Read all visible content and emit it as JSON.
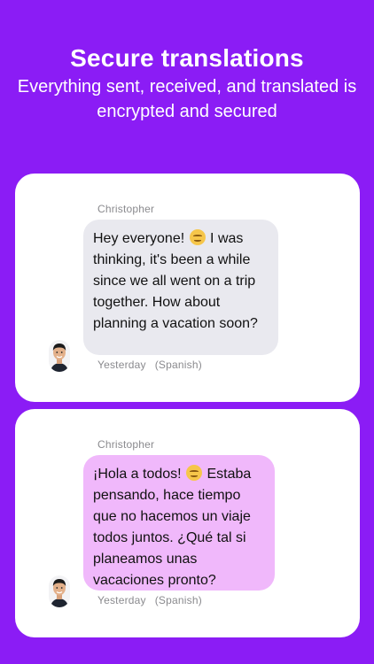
{
  "header": {
    "title": "Secure translations",
    "subtitle": "Everything sent, received, and translated is encrypted and secured"
  },
  "messages": [
    {
      "sender": "Christopher",
      "text_before_emoji": "Hey everyone! ",
      "emoji": "slightly-smiling-face",
      "text_after_emoji": " I was thinking, it's been a while since we all went on a trip together. How about planning a vacation soon?",
      "time": "Yesterday",
      "language": "(Spanish)",
      "bubble_color": "#e9e9ef"
    },
    {
      "sender": "Christopher",
      "text_before_emoji": "¡Hola a todos! ",
      "emoji": "slightly-smiling-face",
      "text_after_emoji": " Estaba pensando, hace tiempo que no hacemos un viaje todos juntos. ¿Qué tal si planeamos unas vacaciones pronto?",
      "time": "Yesterday",
      "language": "(Spanish)",
      "bubble_color": "#f0b8fb"
    }
  ],
  "colors": {
    "background": "#8b1cf5",
    "card": "#ffffff",
    "meta_text": "#8a8a8e"
  }
}
